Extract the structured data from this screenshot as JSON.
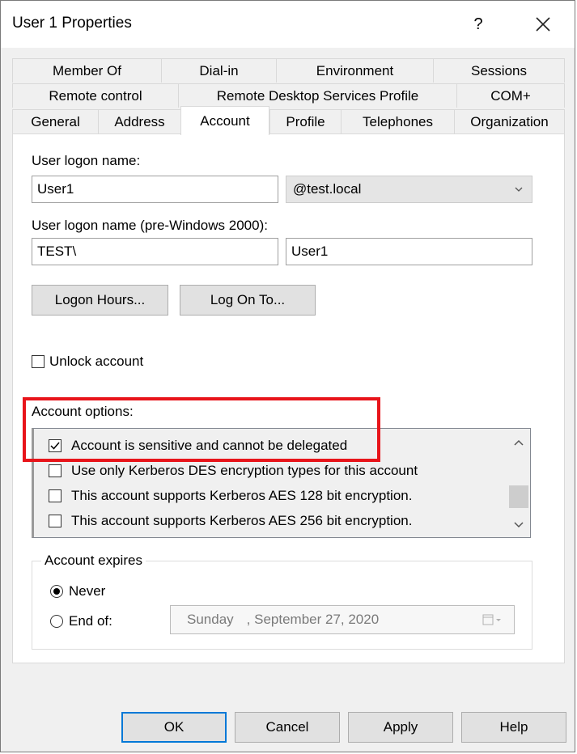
{
  "window": {
    "title": "User 1 Properties",
    "help": "?",
    "close_icon": "close-icon"
  },
  "tabs": {
    "row1": [
      "Member Of",
      "Dial-in",
      "Environment",
      "Sessions"
    ],
    "row2": [
      "Remote control",
      "Remote Desktop Services Profile",
      "COM+"
    ],
    "row3": [
      "General",
      "Address",
      "Account",
      "Profile",
      "Telephones",
      "Organization"
    ],
    "active": "Account"
  },
  "account": {
    "logon_name_label": "User logon name:",
    "logon_name_value": "User1",
    "domain_value": "@test.local",
    "pre2000_label": "User logon name (pre-Windows 2000):",
    "pre2000_domain": "TEST\\",
    "pre2000_user": "User1",
    "logon_hours_button": "Logon Hours...",
    "log_on_to_button": "Log On To...",
    "unlock_label": "Unlock account",
    "options_label": "Account options:",
    "options": [
      {
        "label": "Account is sensitive and cannot be delegated",
        "checked": true
      },
      {
        "label": "Use only Kerberos DES encryption types for this account",
        "checked": false
      },
      {
        "label": "This account supports Kerberos AES 128 bit encryption.",
        "checked": false
      },
      {
        "label": "This account supports Kerberos AES 256 bit encryption.",
        "checked": false
      }
    ],
    "expires_label": "Account expires",
    "never_label": "Never",
    "end_of_label": "End of:",
    "date_day": "Sunday",
    "date_rest": ", September 27, 2020"
  },
  "footer": {
    "ok": "OK",
    "cancel": "Cancel",
    "apply": "Apply",
    "help": "Help"
  },
  "colors": {
    "highlight": "#e8141a",
    "default_button_border": "#0078d7"
  }
}
